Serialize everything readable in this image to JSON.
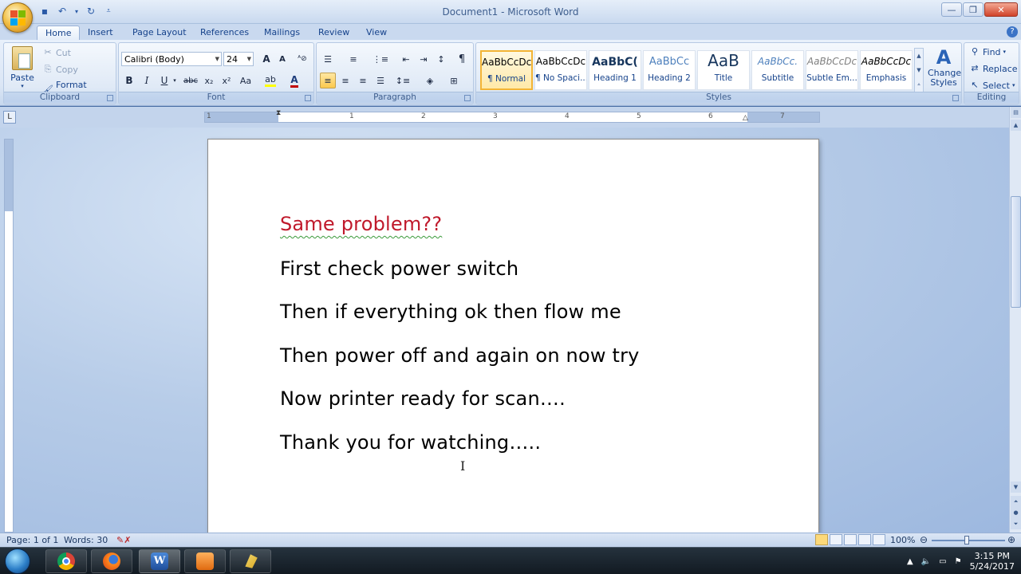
{
  "window": {
    "title": "Document1 - Microsoft Word",
    "controls": {
      "minimize": "—",
      "maximize": "❐",
      "close": "✕"
    }
  },
  "quick_access": [
    {
      "name": "save-icon",
      "glyph": "💾"
    },
    {
      "name": "undo-icon",
      "glyph": "↶"
    },
    {
      "name": "redo-icon",
      "glyph": "↻"
    },
    {
      "name": "customize-qat-icon",
      "glyph": "▾"
    }
  ],
  "tabs": [
    "Home",
    "Insert",
    "Page Layout",
    "References",
    "Mailings",
    "Review",
    "View"
  ],
  "active_tab": "Home",
  "help_label": "?",
  "ribbon": {
    "clipboard": {
      "label": "Clipboard",
      "paste": "Paste",
      "cut": "Cut",
      "copy": "Copy",
      "format_painter": "Format Painter"
    },
    "font": {
      "label": "Font",
      "font_name": "Calibri (Body)",
      "font_size": "24",
      "bold": "B",
      "italic": "I",
      "underline": "U",
      "strike": "abc",
      "subscript": "x₂",
      "superscript": "x²",
      "change_case": "Aa",
      "grow": "A",
      "shrink": "A"
    },
    "paragraph": {
      "label": "Paragraph",
      "show_hide": "¶"
    },
    "styles": {
      "label": "Styles",
      "items": [
        {
          "preview": "AaBbCcDc",
          "name": "¶ Normal",
          "selected": true
        },
        {
          "preview": "AaBbCcDc",
          "name": "¶ No Spaci..."
        },
        {
          "preview": "AaBbC(",
          "name": "Heading 1"
        },
        {
          "preview": "AaBbCc",
          "name": "Heading 2"
        },
        {
          "preview": "AaB",
          "name": "Title"
        },
        {
          "preview": "AaBbCc.",
          "name": "Subtitle"
        },
        {
          "preview": "AaBbCcDc",
          "name": "Subtle Em..."
        },
        {
          "preview": "AaBbCcDc",
          "name": "Emphasis"
        }
      ],
      "change_styles": "Change Styles"
    },
    "editing": {
      "label": "Editing",
      "find": "Find",
      "replace": "Replace",
      "select": "Select"
    }
  },
  "ruler_numbers": [
    "1",
    "1",
    "2",
    "3",
    "4",
    "5",
    "6",
    "7"
  ],
  "document": {
    "lines": [
      "Same problem??",
      "First check power switch",
      "Then if everything ok then flow me",
      "Then power off and again on now try",
      "Now printer ready for scan….",
      "Thank you for watching….."
    ],
    "first_line_color": "#c0192b"
  },
  "status": {
    "page": "Page: 1 of 1",
    "words": "Words: 30",
    "zoom": "100%"
  },
  "taskbar": {
    "time": "3:15 PM",
    "date": "5/24/2017",
    "apps": [
      "chrome",
      "firefox",
      "word",
      "media",
      "app"
    ]
  },
  "colors": {
    "accent": "#15428b",
    "ribbon_bg": "#dbe6f5",
    "selected_style": "#ffe9a8"
  }
}
